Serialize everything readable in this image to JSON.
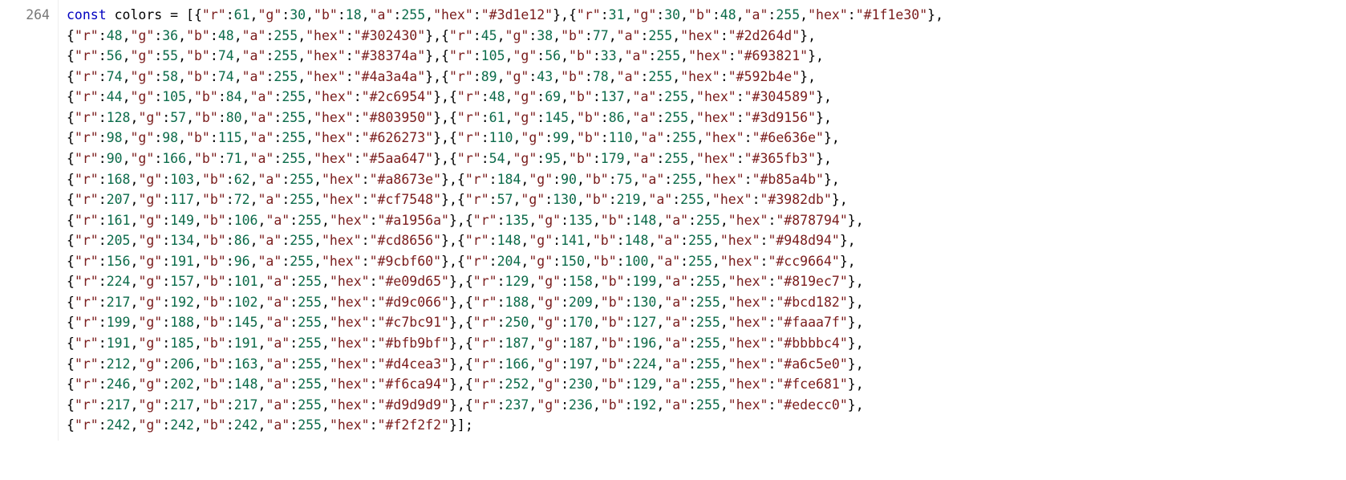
{
  "editor": {
    "line_number": "264",
    "keyword_const": "const",
    "var_name": "colors",
    "equals": "=",
    "open": "[",
    "close": "];",
    "objects": [
      {
        "r": 61,
        "g": 30,
        "b": 18,
        "a": 255,
        "hex": "#3d1e12"
      },
      {
        "r": 31,
        "g": 30,
        "b": 48,
        "a": 255,
        "hex": "#1f1e30"
      },
      {
        "r": 48,
        "g": 36,
        "b": 48,
        "a": 255,
        "hex": "#302430"
      },
      {
        "r": 45,
        "g": 38,
        "b": 77,
        "a": 255,
        "hex": "#2d264d"
      },
      {
        "r": 56,
        "g": 55,
        "b": 74,
        "a": 255,
        "hex": "#38374a"
      },
      {
        "r": 105,
        "g": 56,
        "b": 33,
        "a": 255,
        "hex": "#693821"
      },
      {
        "r": 74,
        "g": 58,
        "b": 74,
        "a": 255,
        "hex": "#4a3a4a"
      },
      {
        "r": 89,
        "g": 43,
        "b": 78,
        "a": 255,
        "hex": "#592b4e"
      },
      {
        "r": 44,
        "g": 105,
        "b": 84,
        "a": 255,
        "hex": "#2c6954"
      },
      {
        "r": 48,
        "g": 69,
        "b": 137,
        "a": 255,
        "hex": "#304589"
      },
      {
        "r": 128,
        "g": 57,
        "b": 80,
        "a": 255,
        "hex": "#803950"
      },
      {
        "r": 61,
        "g": 145,
        "b": 86,
        "a": 255,
        "hex": "#3d9156"
      },
      {
        "r": 98,
        "g": 98,
        "b": 115,
        "a": 255,
        "hex": "#626273"
      },
      {
        "r": 110,
        "g": 99,
        "b": 110,
        "a": 255,
        "hex": "#6e636e"
      },
      {
        "r": 90,
        "g": 166,
        "b": 71,
        "a": 255,
        "hex": "#5aa647"
      },
      {
        "r": 54,
        "g": 95,
        "b": 179,
        "a": 255,
        "hex": "#365fb3"
      },
      {
        "r": 168,
        "g": 103,
        "b": 62,
        "a": 255,
        "hex": "#a8673e"
      },
      {
        "r": 184,
        "g": 90,
        "b": 75,
        "a": 255,
        "hex": "#b85a4b"
      },
      {
        "r": 207,
        "g": 117,
        "b": 72,
        "a": 255,
        "hex": "#cf7548"
      },
      {
        "r": 57,
        "g": 130,
        "b": 219,
        "a": 255,
        "hex": "#3982db"
      },
      {
        "r": 161,
        "g": 149,
        "b": 106,
        "a": 255,
        "hex": "#a1956a"
      },
      {
        "r": 135,
        "g": 135,
        "b": 148,
        "a": 255,
        "hex": "#878794"
      },
      {
        "r": 205,
        "g": 134,
        "b": 86,
        "a": 255,
        "hex": "#cd8656"
      },
      {
        "r": 148,
        "g": 141,
        "b": 148,
        "a": 255,
        "hex": "#948d94"
      },
      {
        "r": 156,
        "g": 191,
        "b": 96,
        "a": 255,
        "hex": "#9cbf60"
      },
      {
        "r": 204,
        "g": 150,
        "b": 100,
        "a": 255,
        "hex": "#cc9664"
      },
      {
        "r": 224,
        "g": 157,
        "b": 101,
        "a": 255,
        "hex": "#e09d65"
      },
      {
        "r": 129,
        "g": 158,
        "b": 199,
        "a": 255,
        "hex": "#819ec7"
      },
      {
        "r": 217,
        "g": 192,
        "b": 102,
        "a": 255,
        "hex": "#d9c066"
      },
      {
        "r": 188,
        "g": 209,
        "b": 130,
        "a": 255,
        "hex": "#bcd182"
      },
      {
        "r": 199,
        "g": 188,
        "b": 145,
        "a": 255,
        "hex": "#c7bc91"
      },
      {
        "r": 250,
        "g": 170,
        "b": 127,
        "a": 255,
        "hex": "#faaa7f"
      },
      {
        "r": 191,
        "g": 185,
        "b": 191,
        "a": 255,
        "hex": "#bfb9bf"
      },
      {
        "r": 187,
        "g": 187,
        "b": 196,
        "a": 255,
        "hex": "#bbbbc4"
      },
      {
        "r": 212,
        "g": 206,
        "b": 163,
        "a": 255,
        "hex": "#d4cea3"
      },
      {
        "r": 166,
        "g": 197,
        "b": 224,
        "a": 255,
        "hex": "#a6c5e0"
      },
      {
        "r": 246,
        "g": 202,
        "b": 148,
        "a": 255,
        "hex": "#f6ca94"
      },
      {
        "r": 252,
        "g": 230,
        "b": 129,
        "a": 255,
        "hex": "#fce681"
      },
      {
        "r": 217,
        "g": 217,
        "b": 217,
        "a": 255,
        "hex": "#d9d9d9"
      },
      {
        "r": 237,
        "g": 236,
        "b": 192,
        "a": 255,
        "hex": "#edecc0"
      },
      {
        "r": 242,
        "g": 242,
        "b": 242,
        "a": 255,
        "hex": "#f2f2f2"
      }
    ],
    "line_breaks": [
      2,
      4,
      6,
      8,
      10,
      12,
      14,
      16,
      18,
      20,
      22,
      24,
      26,
      28,
      30,
      32,
      34,
      36,
      38,
      40,
      41
    ]
  }
}
